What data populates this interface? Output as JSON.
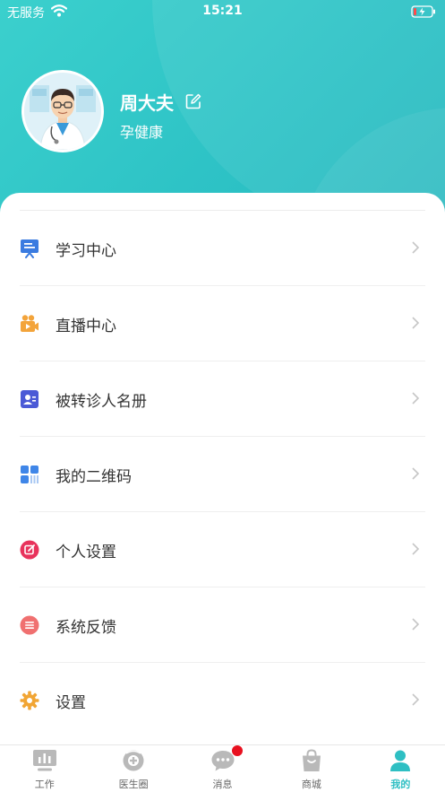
{
  "status_bar": {
    "carrier": "无服务",
    "time": "15:21"
  },
  "profile": {
    "name": "周大夫",
    "organization": "孕健康"
  },
  "menu": [
    {
      "label": "学习中心",
      "icon": "lecture-board-icon",
      "color": "#3a7be0"
    },
    {
      "label": "直播中心",
      "icon": "video-camera-icon",
      "color": "#f3a43b"
    },
    {
      "label": "被转诊人名册",
      "icon": "contact-card-icon",
      "color": "#4b5ad6"
    },
    {
      "label": "我的二维码",
      "icon": "qr-code-icon",
      "color": "#3f86e8"
    },
    {
      "label": "个人设置",
      "icon": "edit-profile-icon",
      "color": "#e8335c"
    },
    {
      "label": "系统反馈",
      "icon": "feedback-icon",
      "color": "#f07070"
    },
    {
      "label": "设置",
      "icon": "gear-icon",
      "color": "#f1a534"
    }
  ],
  "tabs": [
    {
      "label": "工作",
      "icon": "chart-board-icon",
      "active": false
    },
    {
      "label": "医生圈",
      "icon": "doctor-circle-icon",
      "active": false
    },
    {
      "label": "消息",
      "icon": "chat-bubble-icon",
      "active": false,
      "badge": true
    },
    {
      "label": "商城",
      "icon": "shopping-bag-icon",
      "active": false
    },
    {
      "label": "我的",
      "icon": "person-icon",
      "active": true
    }
  ],
  "colors": {
    "accent": "#2ec3c6",
    "tab_active": "#2ebfc3",
    "badge": "#e8101f"
  }
}
